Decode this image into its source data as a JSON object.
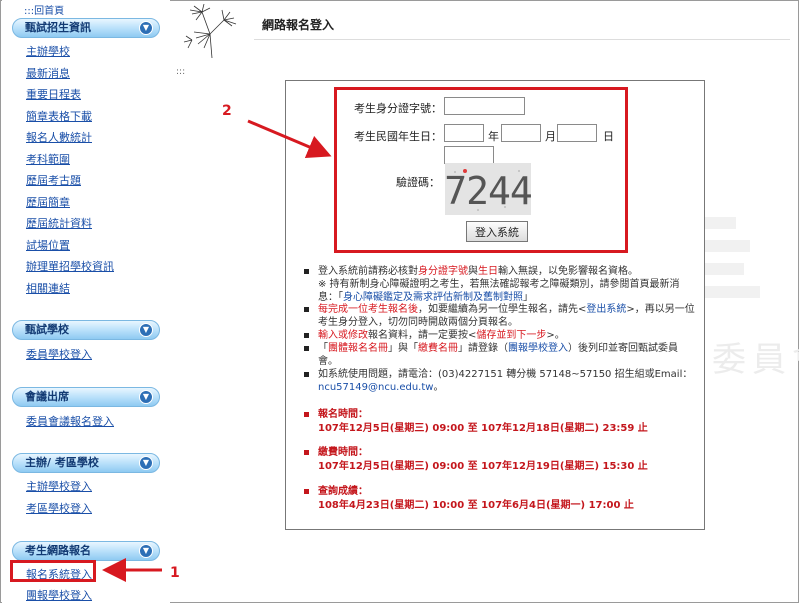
{
  "page": {
    "title": "網路報名登入"
  },
  "sidebar": {
    "home": ":::回首頁",
    "sections": [
      {
        "title": "甄試招生資訊",
        "items": [
          "主辦學校",
          "最新消息",
          "重要日程表",
          "簡章表格下載",
          "報名人數統計",
          "考科範圍",
          "歷屆考古題",
          "歷屆簡章",
          "歷屆統計資料",
          "試場位置",
          "辦理單招學校資訊",
          "相關連結"
        ]
      },
      {
        "title": "甄試學校",
        "items": [
          "委員學校登入"
        ]
      },
      {
        "title": "會議出席",
        "items": [
          "委員會議報名登入"
        ]
      },
      {
        "title": "主辦/ 考區學校",
        "items": [
          "主辦學校登入",
          "考區學校登入"
        ]
      },
      {
        "title": "考生網路報名",
        "items": [
          "報名系統登入",
          "團報學校登入"
        ]
      }
    ]
  },
  "login": {
    "id_label": "考生身分證字號：",
    "id_value": "",
    "birth_label": "考生民國年生日：",
    "year_unit": "年",
    "month_unit": "月",
    "day_unit": "日",
    "captcha_label": "驗證碼：",
    "captcha_text": "7244",
    "captcha_input_value": "",
    "submit_label": "登入系統"
  },
  "notices": [
    {
      "parts": [
        {
          "t": "登入系統前請務必核對",
          "c": ""
        },
        {
          "t": "身分證字號",
          "c": "red"
        },
        {
          "t": "與",
          "c": ""
        },
        {
          "t": "生日",
          "c": "red"
        },
        {
          "t": "輸入無誤，以免影響報名資格。",
          "c": ""
        }
      ],
      "sub": [
        {
          "t": "※ 持有新制身心障礙證明之考生，若無法確認報考之障礙類別，請參閱首頁最新消息：「",
          "c": ""
        },
        {
          "t": "身心障礙鑑定及需求評估新制及舊制對照",
          "c": "blue"
        },
        {
          "t": "」",
          "c": ""
        }
      ]
    },
    {
      "parts": [
        {
          "t": "每完成一位考生報名後",
          "c": "red"
        },
        {
          "t": "，如要繼續為另一位學生報名，請先<",
          "c": ""
        },
        {
          "t": "登出系統",
          "c": "blue"
        },
        {
          "t": ">，再以另一位考生身分登入，切勿同時開啟兩個分頁報名。",
          "c": ""
        }
      ],
      "sub": []
    },
    {
      "parts": [
        {
          "t": "輸入或修改",
          "c": "red"
        },
        {
          "t": "報名資料，請一定要按<",
          "c": ""
        },
        {
          "t": "儲存並到下一步",
          "c": "red"
        },
        {
          "t": ">。",
          "c": ""
        }
      ],
      "sub": []
    },
    {
      "parts": [
        {
          "t": "「",
          "c": ""
        },
        {
          "t": "團體報名名冊",
          "c": "red"
        },
        {
          "t": "」與「",
          "c": ""
        },
        {
          "t": "繳費名冊",
          "c": "red"
        },
        {
          "t": "」請登錄（",
          "c": ""
        },
        {
          "t": "團報學校登入",
          "c": "blue"
        },
        {
          "t": "）後列印並寄回甄試委員會。",
          "c": ""
        }
      ],
      "sub": []
    },
    {
      "parts": [
        {
          "t": "如系統使用問題，請電洽：(03)4227151 轉分機 57148~57150 招生組或Email：",
          "c": ""
        },
        {
          "t": "ncu57149@ncu.edu.tw",
          "c": "blue"
        },
        {
          "t": "。",
          "c": ""
        }
      ],
      "sub": []
    }
  ],
  "schedule": [
    {
      "title": "報名時間：",
      "time": "107年12月5日(星期三) 09:00 至 107年12月18日(星期二) 23:59 止"
    },
    {
      "title": "繳費時間：",
      "time": "107年12月5日(星期三) 09:00 至 107年12月19日(星期三) 15:30 止"
    },
    {
      "title": "查詢成績：",
      "time": "108年4月23日(星期二) 10:00 至 107年6月4日(星期一) 17:00 止"
    }
  ],
  "annotations": {
    "one": "1",
    "two": "2"
  },
  "watermark": "委員會",
  "colors": {
    "accent_red": "#d71920",
    "link_blue": "#1a4fa8",
    "sidebar_head": "#bfe3fb"
  }
}
